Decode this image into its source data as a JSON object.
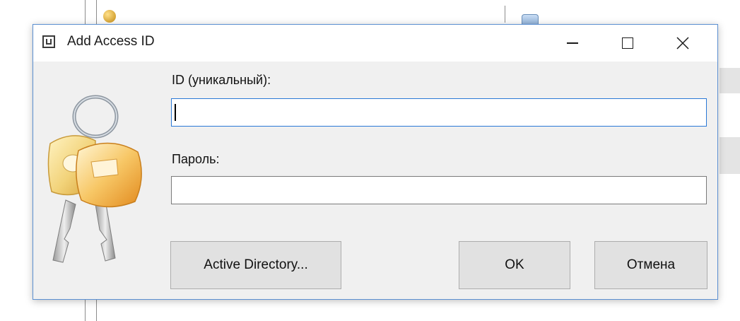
{
  "dialog": {
    "title": "Add Access ID",
    "app_icon": "app-logo-icon",
    "controls": {
      "minimize_icon": "minimize-icon",
      "maximize_icon": "maximize-icon",
      "close_icon": "close-icon"
    },
    "illustration_icon": "keys-icon",
    "id_field": {
      "label": "ID (уникальный):",
      "value": "",
      "placeholder": ""
    },
    "password_field": {
      "label": "Пароль:",
      "value": "",
      "placeholder": ""
    },
    "buttons": {
      "active_directory": "Active Directory...",
      "ok": "OK",
      "cancel": "Отмена"
    }
  },
  "colors": {
    "dialog_border": "#5b8fd1",
    "focus_border": "#2a79d6",
    "dialog_bg": "#f0f0f0",
    "button_bg": "#e1e1e1"
  }
}
